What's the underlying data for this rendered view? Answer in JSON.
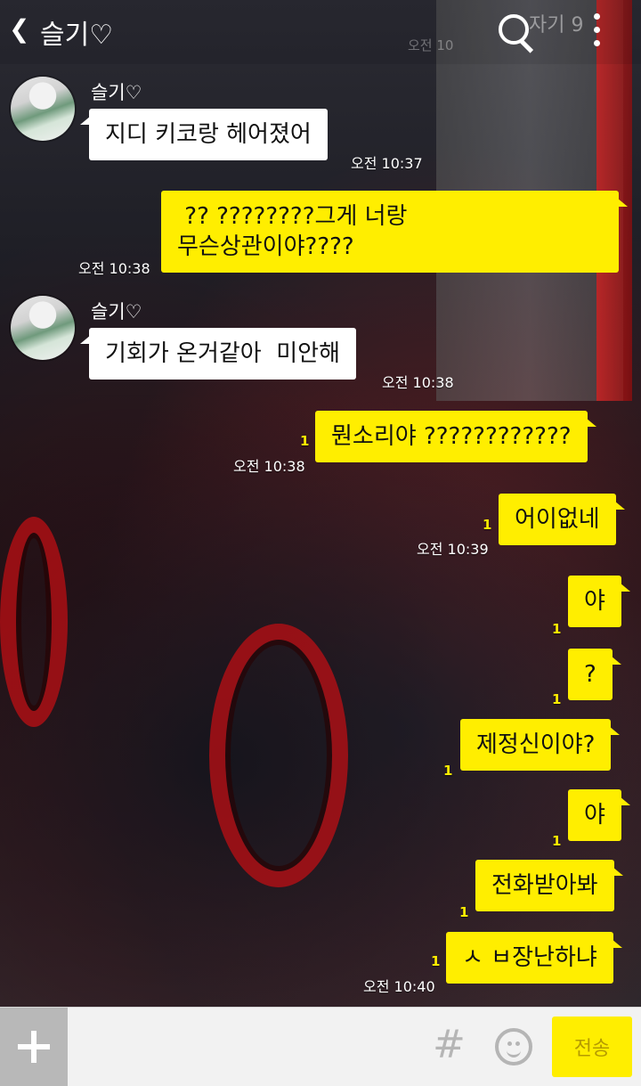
{
  "header": {
    "back_glyph": "❮",
    "title": "슬기♡",
    "search_preview_text": "자기 9",
    "faded_time": "오전 10"
  },
  "messages": [
    {
      "type": "incoming",
      "sender": "슬기♡",
      "text": "지디 키코랑 헤어졌어",
      "time": "오전 10:37"
    },
    {
      "type": "outgoing",
      "text": " ?? ????????그게 너랑\n무슨상관이야????",
      "time": "오전 10:38"
    },
    {
      "type": "incoming",
      "sender": "슬기♡",
      "text": "기회가 온거같아  미안해",
      "time": "오전 10:38"
    },
    {
      "type": "outgoing",
      "unread": "1",
      "text": "뭔소리야 ????????????",
      "time": "오전 10:38"
    },
    {
      "type": "outgoing",
      "unread": "1",
      "text": "어이없네",
      "time": "오전 10:39"
    },
    {
      "type": "outgoing",
      "unread": "1",
      "text": "야"
    },
    {
      "type": "outgoing",
      "unread": "1",
      "text": "?"
    },
    {
      "type": "outgoing",
      "unread": "1",
      "text": "제정신이야?"
    },
    {
      "type": "outgoing",
      "unread": "1",
      "text": "야"
    },
    {
      "type": "outgoing",
      "unread": "1",
      "text": "전화받아봐"
    },
    {
      "type": "outgoing",
      "unread": "1",
      "text": "ㅅ ㅂ장난하냐",
      "time": "오전 10:40"
    }
  ],
  "input_bar": {
    "placeholder": "",
    "send_label": "전송",
    "hash_glyph": "#"
  },
  "colors": {
    "outgoing_bubble": "#ffee00",
    "incoming_bubble": "#ffffff",
    "unread_count": "#ffee00"
  },
  "icons": {
    "back": "chevron-left-icon",
    "search": "search-icon",
    "more": "more-vertical-icon",
    "plus": "plus-icon",
    "hash": "hash-icon",
    "emoji": "emoji-icon"
  }
}
